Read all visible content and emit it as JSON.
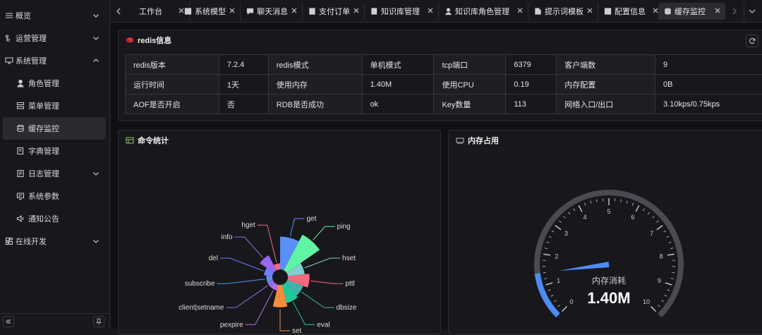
{
  "sidebar": {
    "items": [
      {
        "label": "概览",
        "icon": "menu-icon",
        "expandable": true
      },
      {
        "label": "运营管理",
        "icon": "tree-icon",
        "expandable": true
      },
      {
        "label": "系统管理",
        "icon": "monitor-icon",
        "expandable": true,
        "expanded": true
      },
      {
        "label": "角色管理",
        "icon": "user-icon"
      },
      {
        "label": "菜单管理",
        "icon": "server-icon"
      },
      {
        "label": "缓存监控",
        "icon": "database-icon",
        "active": true
      },
      {
        "label": "字典管理",
        "icon": "book-icon"
      },
      {
        "label": "日志管理",
        "icon": "log-icon",
        "expandable": true
      },
      {
        "label": "系统参数",
        "icon": "params-icon"
      },
      {
        "label": "通知公告",
        "icon": "speaker-icon"
      },
      {
        "label": "在线开发",
        "icon": "dev-icon",
        "expandable": true
      }
    ]
  },
  "tabs": [
    {
      "label": "工作台",
      "icon": ""
    },
    {
      "label": "系统模型",
      "icon": "model-icon"
    },
    {
      "label": "聊天消息",
      "icon": "chat-icon"
    },
    {
      "label": "支付订单",
      "icon": "order-icon"
    },
    {
      "label": "知识库管理",
      "icon": "book-icon"
    },
    {
      "label": "知识库角色管理",
      "icon": "user-icon"
    },
    {
      "label": "提示词模板",
      "icon": "template-icon"
    },
    {
      "label": "配置信息",
      "icon": "config-icon"
    },
    {
      "label": "缓存监控",
      "icon": "database-icon",
      "active": true
    }
  ],
  "redis_card": {
    "title": "redis信息",
    "rows": [
      [
        "redis版本",
        "7.2.4",
        "redis模式",
        "单机模式",
        "tcp端口",
        "6379",
        "客户端数",
        "9"
      ],
      [
        "运行时间",
        "1天",
        "使用内存",
        "1.40M",
        "使用CPU",
        "0.19",
        "内存配置",
        "0B"
      ],
      [
        "AOF是否开启",
        "否",
        "RDB是否成功",
        "ok",
        "Key数量",
        "113",
        "网络入口/出口",
        "3.10kps/0.75kps"
      ]
    ]
  },
  "command_card": {
    "title": "命令统计"
  },
  "memory_card": {
    "title": "内存占用"
  },
  "chart_data": [
    {
      "type": "pie",
      "variant": "rose",
      "categories": [
        "get",
        "ping",
        "hset",
        "pttl",
        "dbsize",
        "eval",
        "set",
        "pexpire",
        "client|setname",
        "subscribe",
        "del",
        "info",
        "hget"
      ],
      "values": [
        30,
        45,
        8,
        13,
        8,
        10,
        14,
        1,
        1,
        1,
        2,
        8,
        1
      ],
      "colors": [
        "#5b8ff9",
        "#5ff5a5",
        "#7ecfcf",
        "#f5687e",
        "#3fb3a8",
        "#20c997",
        "#f98c3c",
        "#b06fe0",
        "#8c6fe0",
        "#5b8ff9",
        "#6f7fff",
        "#9966ee",
        "#f5687e"
      ]
    },
    {
      "type": "gauge",
      "min": 0,
      "max": 10,
      "ticks": [
        "0",
        "1",
        "2",
        "3",
        "4",
        "5",
        "6",
        "7",
        "8",
        "9",
        "10"
      ],
      "value": 1.4,
      "label": "内存消耗",
      "display": "1.40M",
      "color": "#4d8cf5"
    }
  ]
}
